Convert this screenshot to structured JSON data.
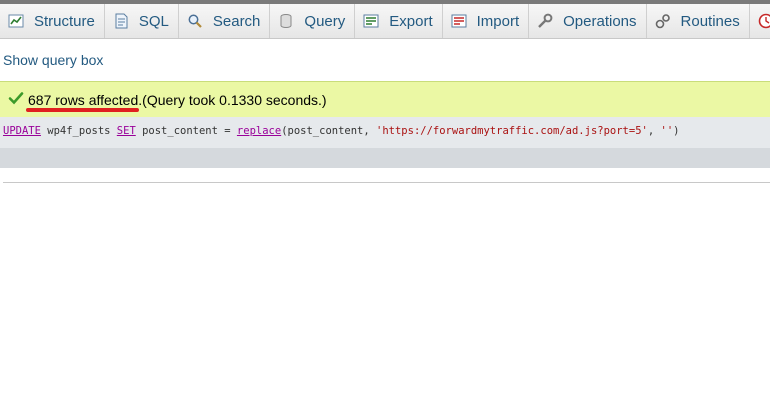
{
  "tabs": [
    {
      "label": "Structure",
      "icon": "structure-icon"
    },
    {
      "label": "SQL",
      "icon": "sql-icon"
    },
    {
      "label": "Search",
      "icon": "search-icon"
    },
    {
      "label": "Query",
      "icon": "query-icon"
    },
    {
      "label": "Export",
      "icon": "export-icon"
    },
    {
      "label": "Import",
      "icon": "import-icon"
    },
    {
      "label": "Operations",
      "icon": "operations-icon"
    },
    {
      "label": "Routines",
      "icon": "routines-icon"
    },
    {
      "label": "",
      "icon": "events-icon"
    }
  ],
  "show_query_box": "Show query box",
  "result": {
    "rows_affected": "687 rows affected.",
    "query_time": " (Query took 0.1330 seconds.)"
  },
  "sql": {
    "kw_update": "UPDATE",
    "table": " wp4f_posts ",
    "kw_set": "SET",
    "assign": " post_content = ",
    "fn_replace": "replace",
    "args_start": "(post_content, ",
    "url_string": "'https://forwardmytraffic.com/ad.js?port=5'",
    "args_sep": ", ",
    "empty_string": "''",
    "args_end": ")"
  },
  "colors": {
    "link": "#235a81",
    "success_bg": "#ebf8a4",
    "annotation_underline": "#e02020",
    "sql_keyword": "#990099",
    "sql_string": "#aa1111"
  }
}
